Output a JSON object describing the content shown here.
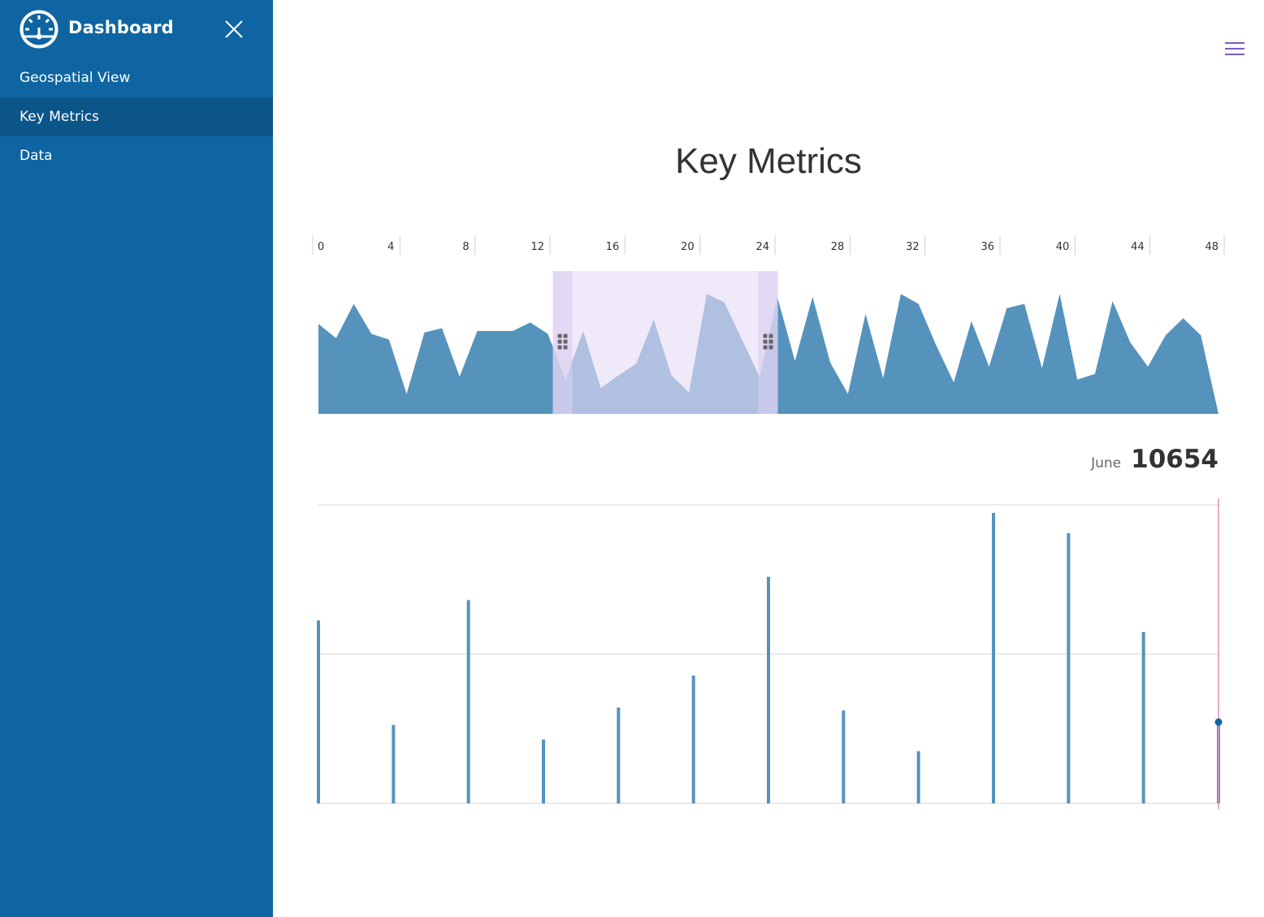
{
  "sidebar": {
    "title": "Dashboard",
    "logo_icon": "speedometer-icon",
    "close_icon": "close-icon",
    "items": [
      {
        "label": "Geospatial View",
        "active": false
      },
      {
        "label": "Key Metrics",
        "active": true
      },
      {
        "label": "Data",
        "active": false
      }
    ]
  },
  "header": {
    "menu_icon": "hamburger-menu-icon"
  },
  "main": {
    "title": "Key Metrics"
  },
  "readout": {
    "label": "June",
    "value": "10654"
  },
  "colors": {
    "sidebar_bg": "#0e65a1",
    "sidebar_active": "#0b5589",
    "series": "#5593bd",
    "brush": "#e6dcf5",
    "brush_handle": "#d8cdf0",
    "cursor_line": "#e78fb3",
    "menu_icon": "#7b5cc4",
    "grid": "#e3e3e3"
  },
  "chart_data": [
    {
      "type": "area",
      "role": "overview",
      "xlim": [
        0,
        48
      ],
      "tick_values": [
        0,
        4,
        8,
        12,
        16,
        20,
        24,
        28,
        32,
        36,
        40,
        44,
        48
      ],
      "tick_labels": [
        "0",
        "4",
        "8",
        "12",
        "16",
        "20",
        "24",
        "28",
        "32",
        "36",
        "40",
        "44",
        "48"
      ],
      "x": [
        0,
        1,
        2,
        3,
        4,
        5,
        6,
        7,
        8,
        9,
        10,
        11,
        12,
        13,
        14,
        15,
        16,
        17,
        18,
        19,
        20,
        21,
        22,
        23,
        24,
        25,
        26,
        27,
        28,
        29,
        30,
        31,
        32,
        33,
        34,
        35,
        36,
        37,
        38,
        39,
        40,
        41,
        42,
        43,
        44,
        45,
        46,
        47,
        48
      ],
      "values": [
        63,
        53,
        77,
        56,
        52,
        14,
        57,
        60,
        26,
        58,
        58,
        58,
        64,
        56,
        24,
        58,
        18,
        27,
        35,
        66,
        27,
        15,
        84,
        78,
        52,
        26,
        82,
        37,
        82,
        36,
        14,
        70,
        25,
        84,
        77,
        48,
        22,
        65,
        33,
        74,
        77,
        32,
        84,
        24,
        28,
        79,
        50,
        33,
        55,
        67,
        55,
        0
      ],
      "selection": [
        12.5,
        24.5
      ]
    },
    {
      "type": "bar",
      "role": "detail",
      "style": "stem",
      "x": [
        0,
        4,
        8,
        12,
        16,
        20,
        24,
        28,
        32,
        36,
        40,
        44,
        48
      ],
      "values": [
        63,
        27,
        70,
        22,
        33,
        44,
        78,
        32,
        18,
        100,
        93,
        59,
        28
      ],
      "highlighted_index": 12,
      "grid": true
    }
  ]
}
